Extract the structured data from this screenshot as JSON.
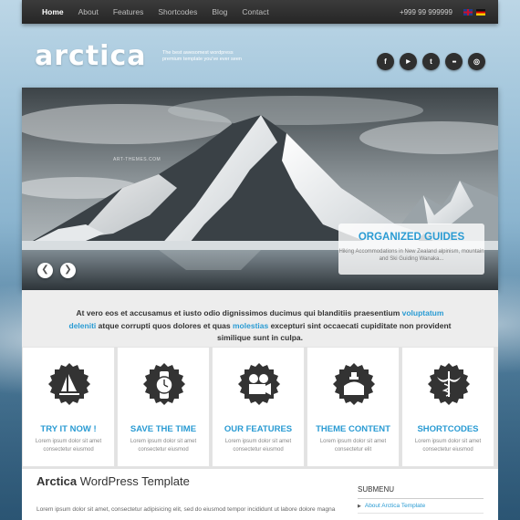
{
  "nav": {
    "items": [
      {
        "label": "Home",
        "active": true
      },
      {
        "label": "Features",
        "active": false
      },
      {
        "label": "Shortcodes",
        "active": false
      },
      {
        "label": "Blog",
        "active": false
      },
      {
        "label": "Contact",
        "active": false
      }
    ],
    "about": {
      "label": "About"
    },
    "phone": "+999 99 999999",
    "languages": [
      "flag-uk-icon",
      "flag-de-icon"
    ]
  },
  "logo": {
    "text": "arctica"
  },
  "tagline": "The best awesomest wordpress premium template you've ever seen",
  "social": [
    {
      "name": "facebook-icon",
      "glyph": "f"
    },
    {
      "name": "youtube-icon",
      "glyph": "▶"
    },
    {
      "name": "twitter-icon",
      "glyph": "t"
    },
    {
      "name": "flickr-icon",
      "glyph": "●●"
    },
    {
      "name": "rss-icon",
      "glyph": "◎"
    }
  ],
  "slider": {
    "watermark": "ART-THEMES.COM",
    "caption_title": "ORGANIZED GUIDES",
    "caption_text": "Hiking Accommodations in New Zealand alpinism, mountain and Ski Guiding Wanaka...",
    "prev": "❮",
    "next": "❯"
  },
  "intro": {
    "part1": "At vero eos et accusamus et iusto odio dignissimos ducimus qui blanditiis praesentium ",
    "link1": "voluptatum deleniti",
    "part2": " atque corrupti quos dolores et quas ",
    "link2": "molestias",
    "part3": " excepturi sint occaecati cupiditate non provident similique sunt in culpa."
  },
  "features": [
    {
      "title": "TRY IT NOW !",
      "text": "Lorem ipsum dolor sit amet consectetur eiusmod",
      "icon": "windsurf-icon"
    },
    {
      "title": "SAVE THE TIME",
      "text": "Lorem ipsum dolor sit amet consectetur eiusmod",
      "icon": "watch-icon"
    },
    {
      "title": "OUR FEATURES",
      "text": "Lorem ipsum dolor sit amet consectetur eiusmod",
      "icon": "film-camera-icon"
    },
    {
      "title": "THEME CONTENT",
      "text": "Lorem ipsum dolor sit amet consectetur elit",
      "icon": "perfume-icon"
    },
    {
      "title": "SHORTCODES",
      "text": "Lorem ipsum dolor sit amet consectetur eiusmod",
      "icon": "caduceus-icon"
    }
  ],
  "content": {
    "title_bold": "Arctica",
    "title_rest": " WordPress Template",
    "body": "Lorem ipsum dolor sit amet, consectetur adipisicing elit, sed do eiusmod tempor incididunt ut labore dolore magna"
  },
  "sidebar": {
    "title": "SUBMENU",
    "items": [
      "About Arctica Template"
    ]
  },
  "colors": {
    "accent": "#2a9bd3",
    "topbar": "#2e2e2e",
    "badge": "#333333"
  }
}
